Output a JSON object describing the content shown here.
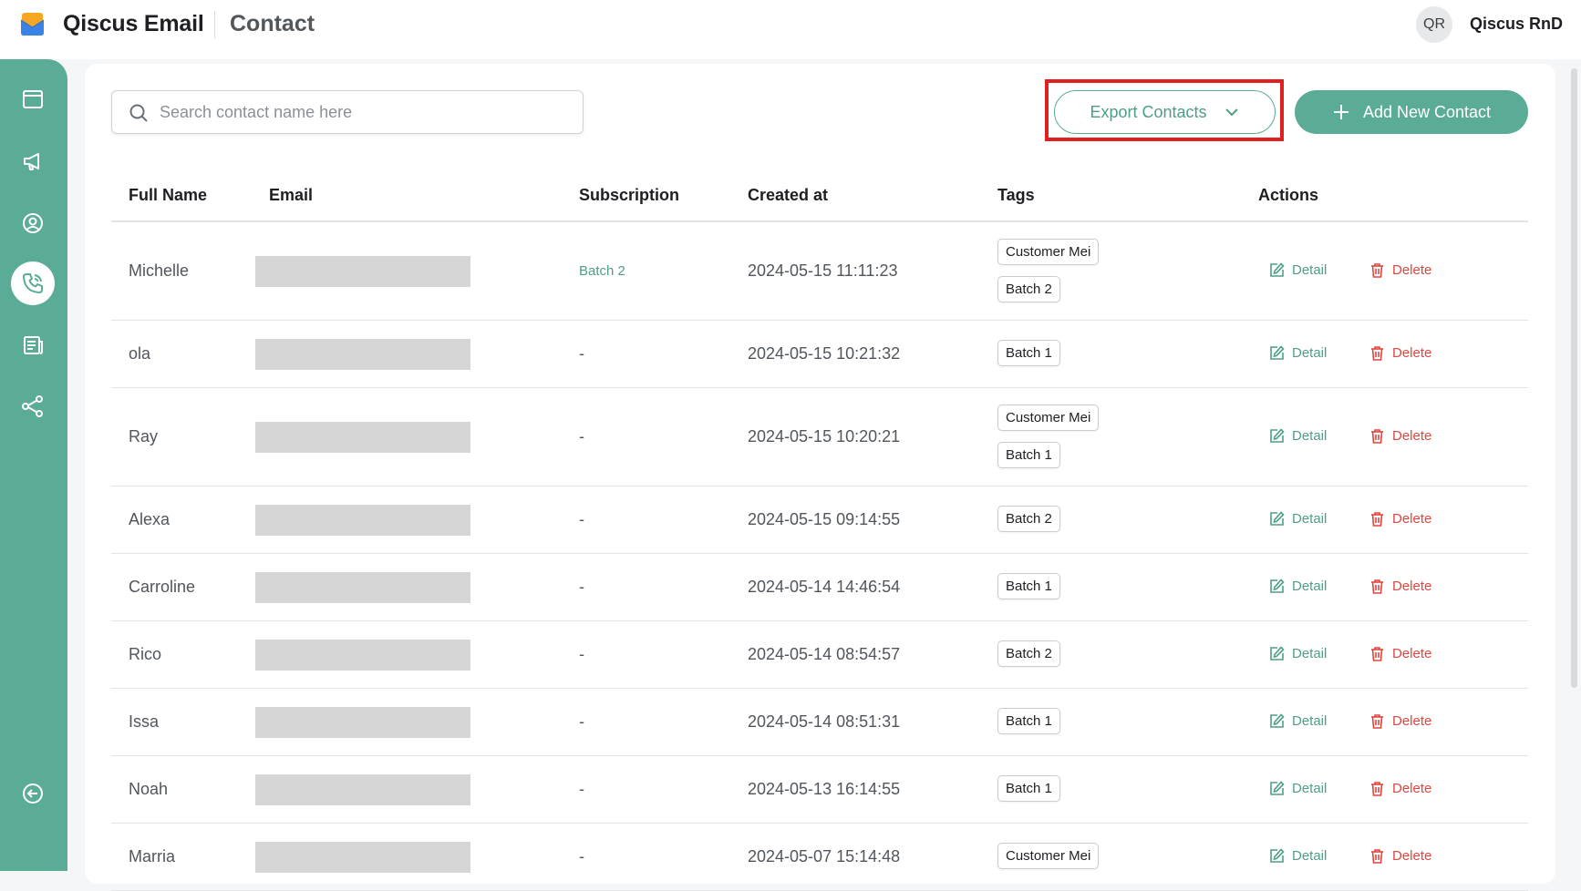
{
  "header": {
    "app_title": "Qiscus Email",
    "page_title": "Contact",
    "user_initials": "QR",
    "user_name": "Qiscus RnD"
  },
  "sidebar": {
    "items": [
      {
        "icon": "window-icon",
        "active": false
      },
      {
        "icon": "megaphone-icon",
        "active": false
      },
      {
        "icon": "user-circle-icon",
        "active": false
      },
      {
        "icon": "phone-icon",
        "active": true
      },
      {
        "icon": "newspaper-icon",
        "active": false
      },
      {
        "icon": "share-nodes-icon",
        "active": false
      }
    ],
    "collapse_icon": "arrow-left-circle-icon"
  },
  "toolbar": {
    "search_placeholder": "Search contact name here",
    "export_label": "Export Contacts",
    "add_label": "Add New Contact"
  },
  "table": {
    "headers": {
      "full_name": "Full Name",
      "email": "Email",
      "subscription": "Subscription",
      "created_at": "Created at",
      "tags": "Tags",
      "actions": "Actions"
    },
    "detail_label": "Detail",
    "delete_label": "Delete",
    "rows": [
      {
        "name": "Michelle",
        "subscription": "Batch 2",
        "created_at": "2024-05-15 11:11:23",
        "tags": [
          "Customer Mei",
          "Batch 2"
        ]
      },
      {
        "name": "ola",
        "subscription": "-",
        "created_at": "2024-05-15 10:21:32",
        "tags": [
          "Batch 1"
        ]
      },
      {
        "name": "Ray",
        "subscription": "-",
        "created_at": "2024-05-15 10:20:21",
        "tags": [
          "Customer Mei",
          "Batch 1"
        ]
      },
      {
        "name": "Alexa",
        "subscription": "-",
        "created_at": "2024-05-15 09:14:55",
        "tags": [
          "Batch 2"
        ]
      },
      {
        "name": "Carroline",
        "subscription": "-",
        "created_at": "2024-05-14 14:46:54",
        "tags": [
          "Batch 1"
        ]
      },
      {
        "name": "Rico",
        "subscription": "-",
        "created_at": "2024-05-14 08:54:57",
        "tags": [
          "Batch 2"
        ]
      },
      {
        "name": "Issa",
        "subscription": "-",
        "created_at": "2024-05-14 08:51:31",
        "tags": [
          "Batch 1"
        ]
      },
      {
        "name": "Noah",
        "subscription": "-",
        "created_at": "2024-05-13 16:14:55",
        "tags": [
          "Batch 1"
        ]
      },
      {
        "name": "Marria",
        "subscription": "-",
        "created_at": "2024-05-07 15:14:48",
        "tags": [
          "Customer Mei"
        ]
      }
    ]
  },
  "colors": {
    "brand": "#5aac96",
    "danger": "#e0463e",
    "highlight": "#e02020"
  }
}
